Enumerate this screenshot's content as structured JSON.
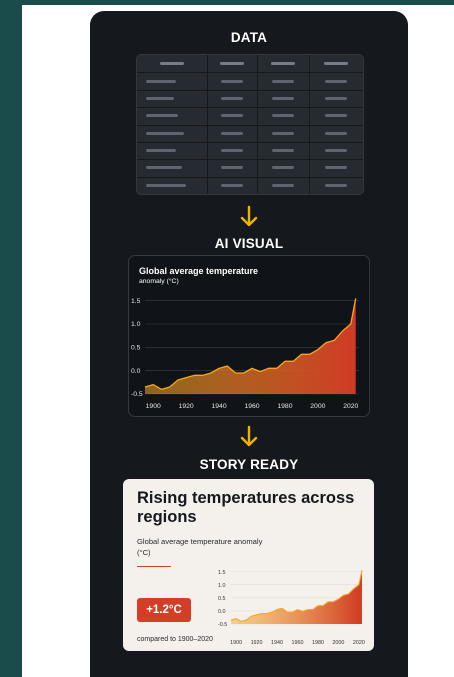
{
  "steps": {
    "data_label": "DATA",
    "visual_label": "AI VISUAL",
    "story_label": "STORY READY"
  },
  "colors": {
    "panel_bg": "#15181d",
    "accent_arrow": "#f0b400",
    "series_line": "#f5a623",
    "area_top": "#d03a24",
    "area_bottom": "#f5a623",
    "badge": "#d23e27",
    "story_bg": "#f4f1ec"
  },
  "icons": {
    "arrow": "arrow-down-icon"
  },
  "table": {
    "rows": 8,
    "columns": 4
  },
  "ai_chart": {
    "title": "Global average temperature",
    "subtitle": "anomaly (°C)"
  },
  "story": {
    "title": "Rising temperatures across regions",
    "subtitle": "Global average temperature anomaly (°C)",
    "badge": "+1.2°C",
    "comparison": "compared to 1900–2020"
  },
  "chart_data": {
    "type": "area",
    "title": "Global average temperature",
    "subtitle": "anomaly (°C)",
    "xlabel": "",
    "ylabel": "",
    "xlim": [
      1895,
      2025
    ],
    "ylim": [
      -0.5,
      1.6
    ],
    "x_ticks": [
      1900,
      1920,
      1940,
      1960,
      1980,
      2000,
      2020
    ],
    "y_ticks": [
      -0.5,
      0.0,
      0.5,
      1.0,
      1.5
    ],
    "y_tick_labels": [
      "-0.5",
      "0.0",
      "0.5",
      "1.0",
      "1.5"
    ],
    "grid": true,
    "x": [
      1895,
      1900,
      1905,
      1910,
      1915,
      1920,
      1925,
      1930,
      1935,
      1940,
      1945,
      1950,
      1955,
      1960,
      1965,
      1970,
      1975,
      1980,
      1985,
      1990,
      1995,
      2000,
      2005,
      2010,
      2015,
      2020,
      2023
    ],
    "y": [
      -0.35,
      -0.3,
      -0.4,
      -0.35,
      -0.2,
      -0.15,
      -0.1,
      -0.1,
      -0.05,
      0.05,
      0.1,
      -0.05,
      -0.05,
      0.05,
      -0.02,
      0.05,
      0.05,
      0.2,
      0.2,
      0.35,
      0.35,
      0.45,
      0.6,
      0.65,
      0.85,
      1.0,
      1.55
    ]
  }
}
